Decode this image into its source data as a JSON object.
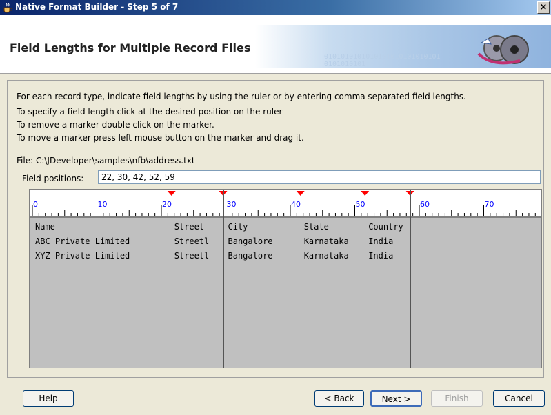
{
  "window": {
    "title": "Native Format Builder - Step 5 of 7",
    "close_glyph": "×"
  },
  "header": {
    "step_title": "Field Lengths for Multiple Record Files",
    "banner_binary": "0101010101010101010101010101\n0101010101"
  },
  "instructions": [
    "For each record type, indicate field lengths by using the ruler or by entering comma separated field lengths.",
    "To specify a field length click at the desired position on the ruler",
    "To remove a marker double click on the marker.",
    "To move a marker press left mouse button on the marker and drag it."
  ],
  "file": {
    "label": "File: C:\\JDeveloper\\samples\\nfb\\address.txt"
  },
  "field_positions": {
    "label": "Field positions:",
    "value": "22, 30, 42, 52, 59"
  },
  "ruler": {
    "tick_labels": [
      "0",
      "10",
      "20",
      "30",
      "40",
      "50",
      "60",
      "70"
    ],
    "marker_positions": [
      22,
      30,
      42,
      52,
      59
    ],
    "marker_color": "#ff0000",
    "label_color": "#0000ff"
  },
  "records": [
    [
      "Name",
      "Street",
      "City",
      "State",
      "Country"
    ],
    [
      "ABC Private Limited",
      "Streetl",
      "Bangalore",
      "Karnataka",
      "India"
    ],
    [
      "XYZ Private Limited",
      "Streetl",
      "Bangalore",
      "Karnataka",
      "India"
    ]
  ],
  "buttons": {
    "help": "Help",
    "back": "< Back",
    "next": "Next >",
    "finish": "Finish",
    "cancel": "Cancel"
  }
}
